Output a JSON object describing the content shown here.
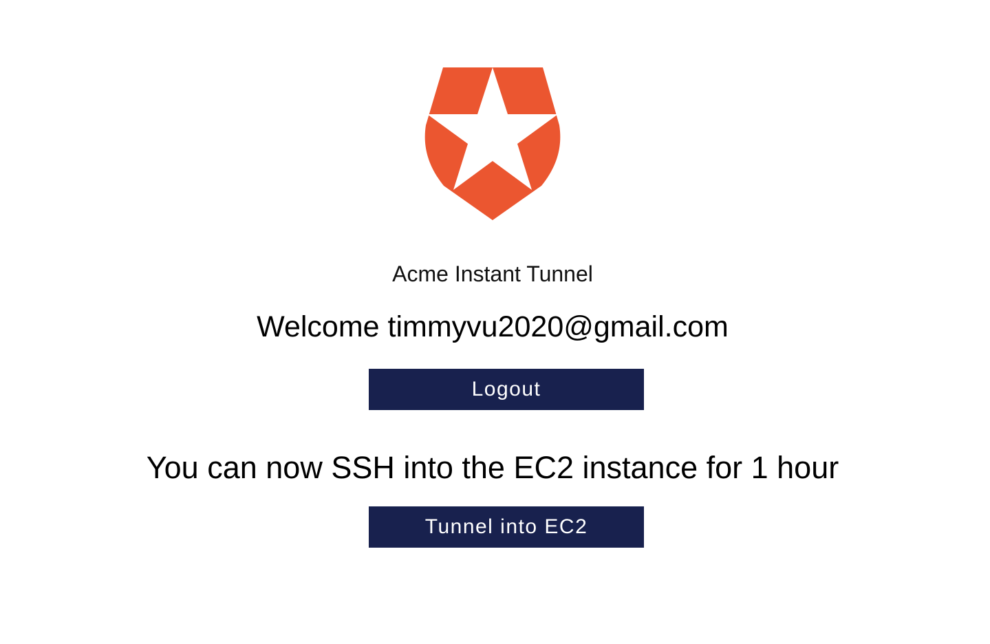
{
  "brand": {
    "logo_icon": "auth0-shield-star-icon",
    "logo_color": "#eb5630",
    "app_title": "Acme Instant Tunnel"
  },
  "welcome": {
    "prefix": "Welcome",
    "email": "timmyvu2020@gmail.com",
    "text": "Welcome timmyvu2020@gmail.com"
  },
  "actions": {
    "logout_label": "Logout",
    "tunnel_label": "Tunnel into EC2",
    "button_color": "#18214e"
  },
  "message": {
    "ssh_text": "You can now SSH into the EC2 instance for 1 hour"
  }
}
